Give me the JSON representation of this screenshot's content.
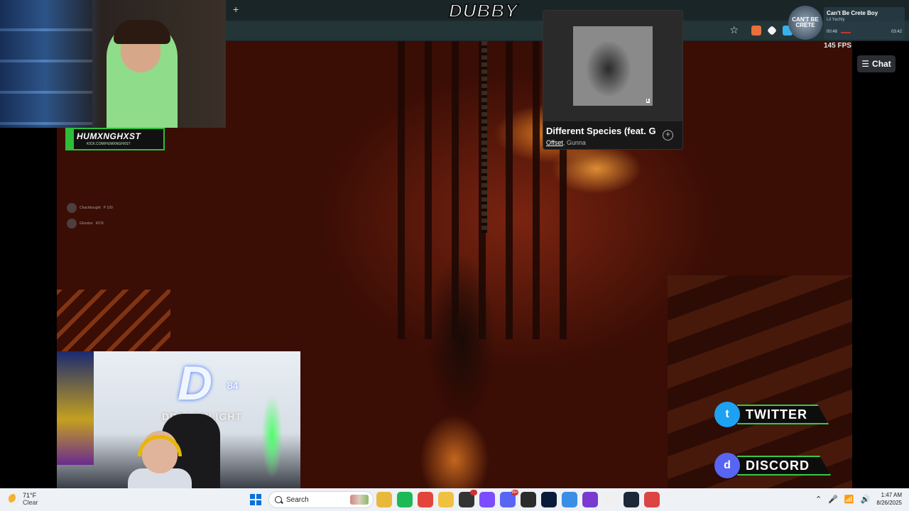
{
  "browser": {
    "new_tab_glyph": "+",
    "bookmark_glyph": "☆"
  },
  "overlay": {
    "stream_title": "DUBBY",
    "fps_label": "145 FPS",
    "chat_button_label": "Chat",
    "chat_button_glyph": "☰",
    "streamer_name": "HUMXNGHXST",
    "streamer_url": "KICK.COM/HUMXNGHXST",
    "chat_lines": [
      {
        "user": "Chachbought",
        "text": "P 100"
      },
      {
        "user": "Ghostus",
        "text": "KICK"
      }
    ],
    "cam2_logo": "D",
    "cam2_number": "84",
    "cam2_sign": "DREADNLIGHT",
    "socials": [
      {
        "label": "TWITTER",
        "glyph": "t",
        "color": "#1da1f2"
      },
      {
        "label": "DISCORD",
        "glyph": "d",
        "color": "#5865f2"
      }
    ]
  },
  "spotify_popup": {
    "song_title": "Different Species (feat. G",
    "artist_primary": "Offset",
    "artist_secondary": ", Gunna",
    "explicit": "E",
    "add_glyph": "+"
  },
  "now_playing": {
    "avatar_text": "CAN'T BE CRETE",
    "title": "Can't Be Crete Boy",
    "artist": "Lil Yachty",
    "elapsed": "00:48",
    "total": "03:42",
    "progress": 0.22
  },
  "taskbar": {
    "weather_temp": "71°F",
    "weather_condition": "Clear",
    "search_placeholder": "Search",
    "apps": [
      {
        "name": "file-explorer",
        "color": "#e8b83a"
      },
      {
        "name": "spotify",
        "color": "#1db954"
      },
      {
        "name": "chrome",
        "color": "#e4453a"
      },
      {
        "name": "folder",
        "color": "#f0c040"
      },
      {
        "name": "app-red",
        "color": "#333",
        "badge": ""
      },
      {
        "name": "app-purple",
        "color": "#7c4dff"
      },
      {
        "name": "discord",
        "color": "#5865f2",
        "badge": "99+"
      },
      {
        "name": "terminal",
        "color": "#2b2b2b"
      },
      {
        "name": "photoshop",
        "color": "#0a1b3a"
      },
      {
        "name": "paint",
        "color": "#3a8ee6"
      },
      {
        "name": "clapper",
        "color": "#7a3ad0"
      },
      {
        "name": "itunes",
        "color": "#f0f0f0"
      },
      {
        "name": "steam",
        "color": "#1b2838"
      },
      {
        "name": "snip",
        "color": "#d44"
      }
    ],
    "tray_glyphs": [
      "⌃",
      "🎤",
      "📶",
      "🔊"
    ],
    "time": "1:47 AM",
    "date": "8/26/2025"
  }
}
